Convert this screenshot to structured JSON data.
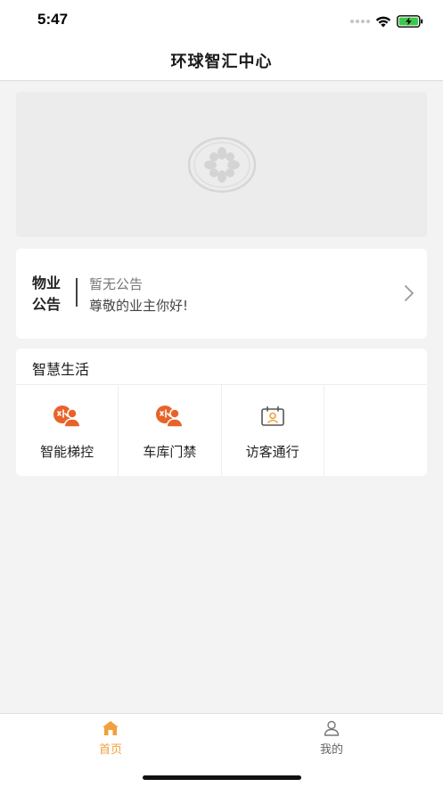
{
  "status_bar": {
    "time": "5:47"
  },
  "header": {
    "title": "环球智汇中心"
  },
  "notice": {
    "logo_top": "物业",
    "logo_bottom": "公告",
    "title": "暂无公告",
    "subtitle": "尊敬的业主你好!"
  },
  "smart_life": {
    "title": "智慧生活",
    "items": [
      {
        "label": "智能梯控",
        "icon": "elevator-call-icon"
      },
      {
        "label": "车库门禁",
        "icon": "garage-access-icon"
      },
      {
        "label": "访客通行",
        "icon": "visitor-pass-icon"
      }
    ]
  },
  "tabbar": {
    "home": "首页",
    "mine": "我的",
    "active_color": "#f0a03c",
    "inactive_color": "#888888"
  },
  "colors": {
    "accent": "#f0a03c",
    "icon_orange": "#e8632a",
    "battery_green": "#3cc94a"
  }
}
